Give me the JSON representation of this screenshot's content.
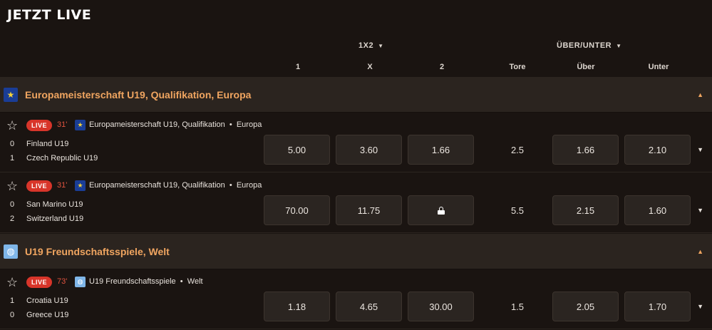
{
  "page_title": "JETZT LIVE",
  "markets": {
    "x12": {
      "label": "1X2",
      "cols": [
        "1",
        "X",
        "2"
      ]
    },
    "ou": {
      "label": "ÜBER/UNTER",
      "cols": [
        "Tore",
        "Über",
        "Unter"
      ]
    }
  },
  "leagues": [
    {
      "name": "Europameisterschaft U19, Qualifikation, Europa",
      "flag": "eu-flag-icon",
      "matches": [
        {
          "live": "LIVE",
          "minute": "31'",
          "league": "Europameisterschaft U19, Qualifikation",
          "region": "Europa",
          "home": {
            "score": "0",
            "name": "Finland U19"
          },
          "away": {
            "score": "1",
            "name": "Czech Republic U19"
          },
          "odds": [
            "5.00",
            "3.60",
            "1.66"
          ],
          "tore": "2.5",
          "ueber": "1.66",
          "unter": "2.10"
        },
        {
          "live": "LIVE",
          "minute": "31'",
          "league": "Europameisterschaft U19, Qualifikation",
          "region": "Europa",
          "home": {
            "score": "0",
            "name": "San Marino U19"
          },
          "away": {
            "score": "2",
            "name": "Switzerland U19"
          },
          "odds": [
            "70.00",
            "11.75",
            "locked"
          ],
          "tore": "5.5",
          "ueber": "2.15",
          "unter": "1.60"
        }
      ]
    },
    {
      "name": "U19 Freundschaftsspiele, Welt",
      "flag": "world-flag-icon",
      "matches": [
        {
          "live": "LIVE",
          "minute": "73'",
          "league": "U19 Freundschaftsspiele",
          "region": "Welt",
          "home": {
            "score": "1",
            "name": "Croatia U19"
          },
          "away": {
            "score": "0",
            "name": "Greece U19"
          },
          "odds": [
            "1.18",
            "4.65",
            "30.00"
          ],
          "tore": "1.5",
          "ueber": "2.05",
          "unter": "1.70"
        }
      ]
    }
  ],
  "colors": {
    "accent": "#f0a560",
    "live": "#d8352a",
    "background": "#1a1411",
    "league_bar": "#2b241f"
  }
}
